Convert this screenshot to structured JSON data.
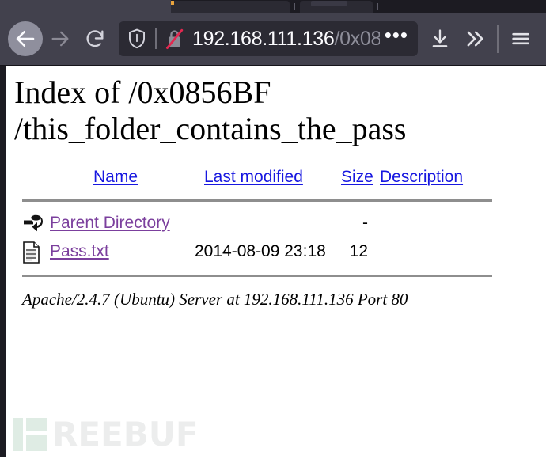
{
  "browser": {
    "back_icon": "back-arrow-icon",
    "forward_icon": "forward-arrow-icon",
    "reload_icon": "reload-icon",
    "shield_icon": "shield-icon",
    "insecure_icon": "broken-lock-icon",
    "url_host": "192.168.111.136",
    "url_path": "/0x08",
    "overflow_dots": "•••",
    "download_icon": "download-icon",
    "chevrons_icon": "double-chevron-right-icon",
    "menu_icon": "hamburger-menu-icon"
  },
  "page": {
    "heading_line1": "Index of /0x0856BF",
    "heading_line2": "/this_folder_contains_the_pass",
    "columns": {
      "name": "Name",
      "last_modified": "Last modified",
      "size": "Size",
      "description": "Description"
    },
    "rows": [
      {
        "icon": "parent-directory-icon",
        "name": "Parent Directory",
        "last_modified": "",
        "size": "-",
        "description": ""
      },
      {
        "icon": "text-file-icon",
        "name": "Pass.txt",
        "last_modified": "2014-08-09 23:18",
        "size": "12",
        "description": ""
      }
    ],
    "footer": "Apache/2.4.7 (Ubuntu) Server at 192.168.111.136 Port 80"
  },
  "watermark": {
    "text": "REEBUF",
    "mark": "freebuf-logo-icon"
  },
  "colors": {
    "chrome": "#42414d",
    "urlbar": "#2b2a33",
    "tabstrip": "#1c1b22",
    "link_header": "#1717e0",
    "link_visited": "#7b3f9d",
    "rule": "#8e8e8e",
    "insecure_slash": "#e22850"
  }
}
